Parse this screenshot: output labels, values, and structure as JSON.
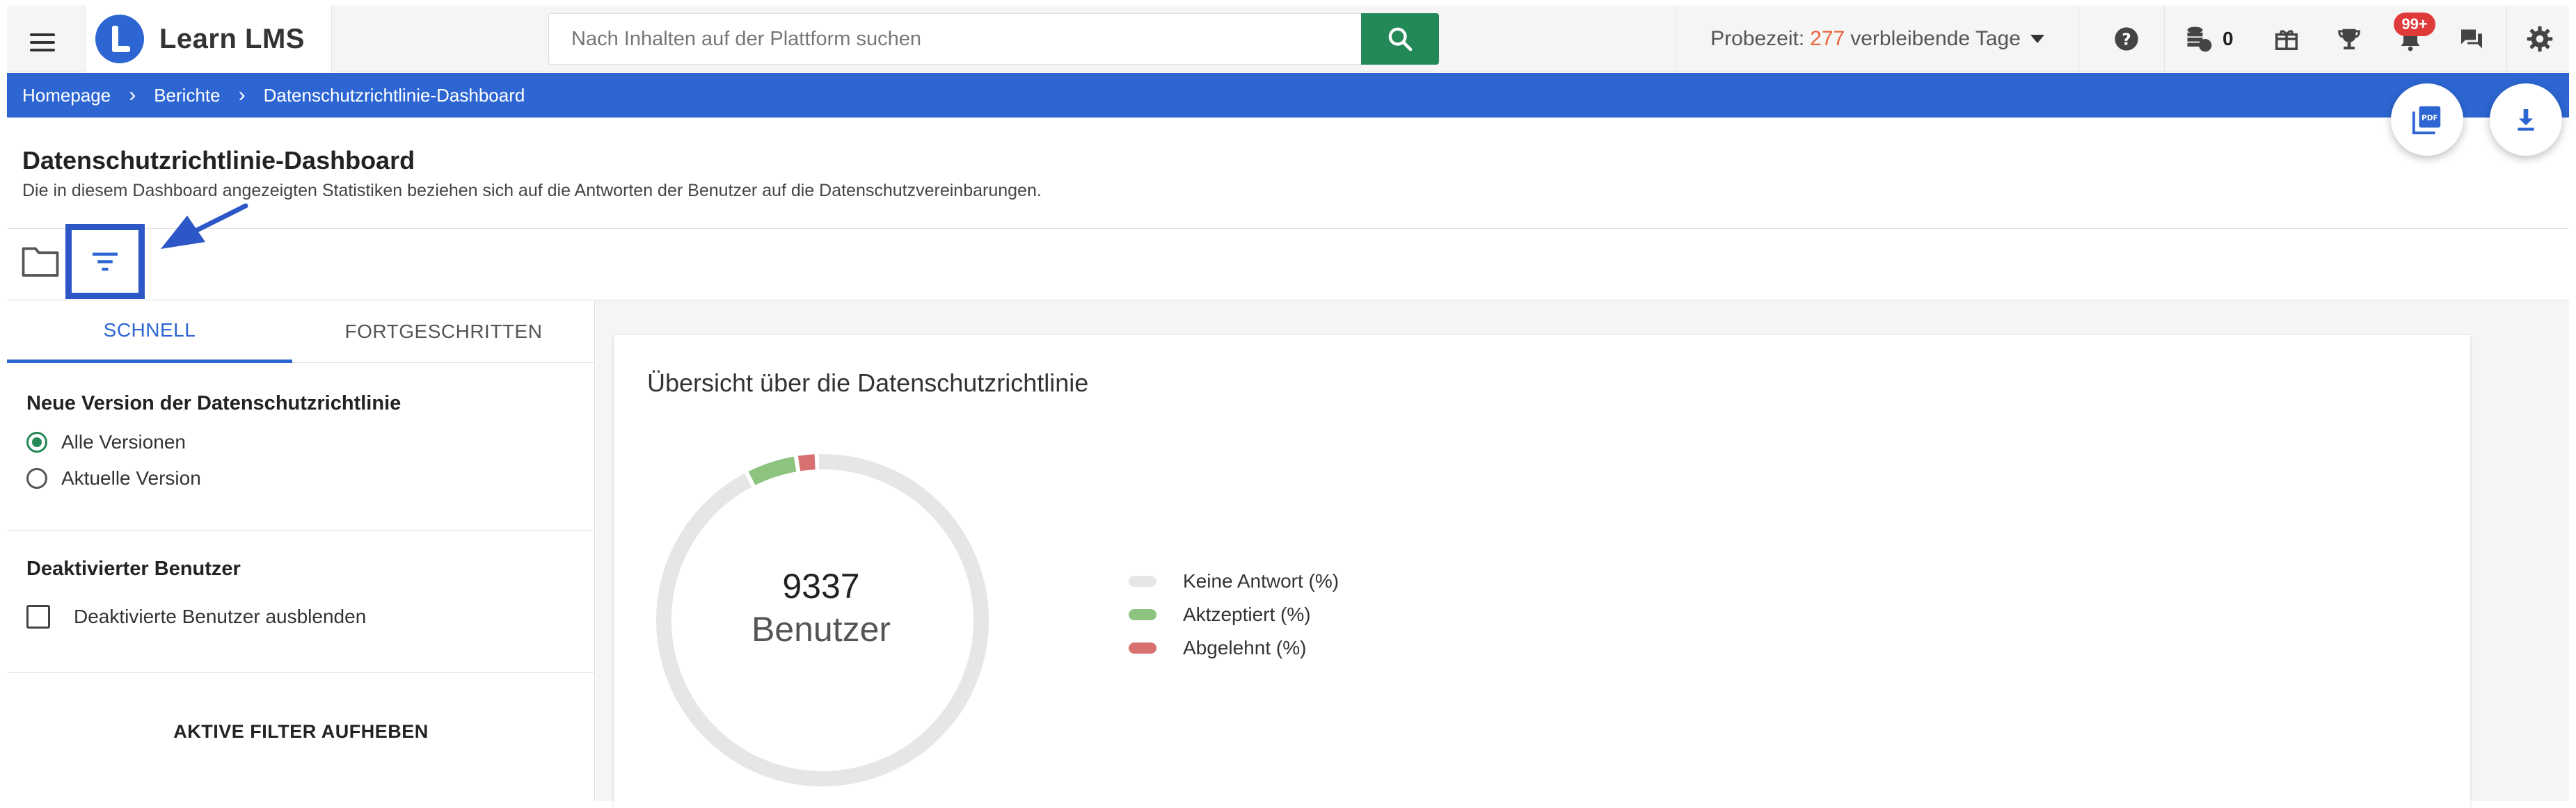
{
  "header": {
    "app_name": "Learn LMS",
    "search_placeholder": "Nach Inhalten auf der Plattform suchen",
    "trial_prefix": "Probezeit:",
    "trial_days": "277",
    "trial_suffix": "verbleibende Tage",
    "coins": "0",
    "notifications_badge": "99+"
  },
  "breadcrumb": {
    "items": [
      "Homepage",
      "Berichte",
      "Datenschutzrichtlinie-Dashboard"
    ]
  },
  "page": {
    "title": "Datenschutzrichtlinie-Dashboard",
    "description": "Die in diesem Dashboard angezeigten Statistiken beziehen sich auf die Antworten der Benutzer auf die Datenschutzvereinbarungen."
  },
  "filters": {
    "tabs": [
      "SCHNELL",
      "FORTGESCHRITTEN"
    ],
    "version_title": "Neue Version der Datenschutzrichtlinie",
    "version_options": [
      "Alle Versionen",
      "Aktuelle Version"
    ],
    "selected_version": "Alle Versionen",
    "deactivated_title": "Deaktivierter Benutzer",
    "deactivated_checkbox": "Deaktivierte Benutzer ausblenden",
    "clear_button": "AKTIVE FILTER AUFHEBEN"
  },
  "overview": {
    "title": "Übersicht über die Datenschutzrichtlinie",
    "total": "9337",
    "total_label": "Benutzer"
  },
  "chart_data": {
    "type": "pie",
    "categories": [
      "Keine Antwort (%)",
      "Aktzeptiert (%)",
      "Abgelehnt (%)"
    ],
    "values": [
      93,
      5,
      2
    ],
    "colors": [
      "#e6e6e6",
      "#8cc47f",
      "#d97070"
    ],
    "legend": "right"
  },
  "colors": {
    "primary": "#2d66d2",
    "search_button": "#238a57",
    "trial_days": "#e8643b",
    "badge": "#e03b3b"
  }
}
